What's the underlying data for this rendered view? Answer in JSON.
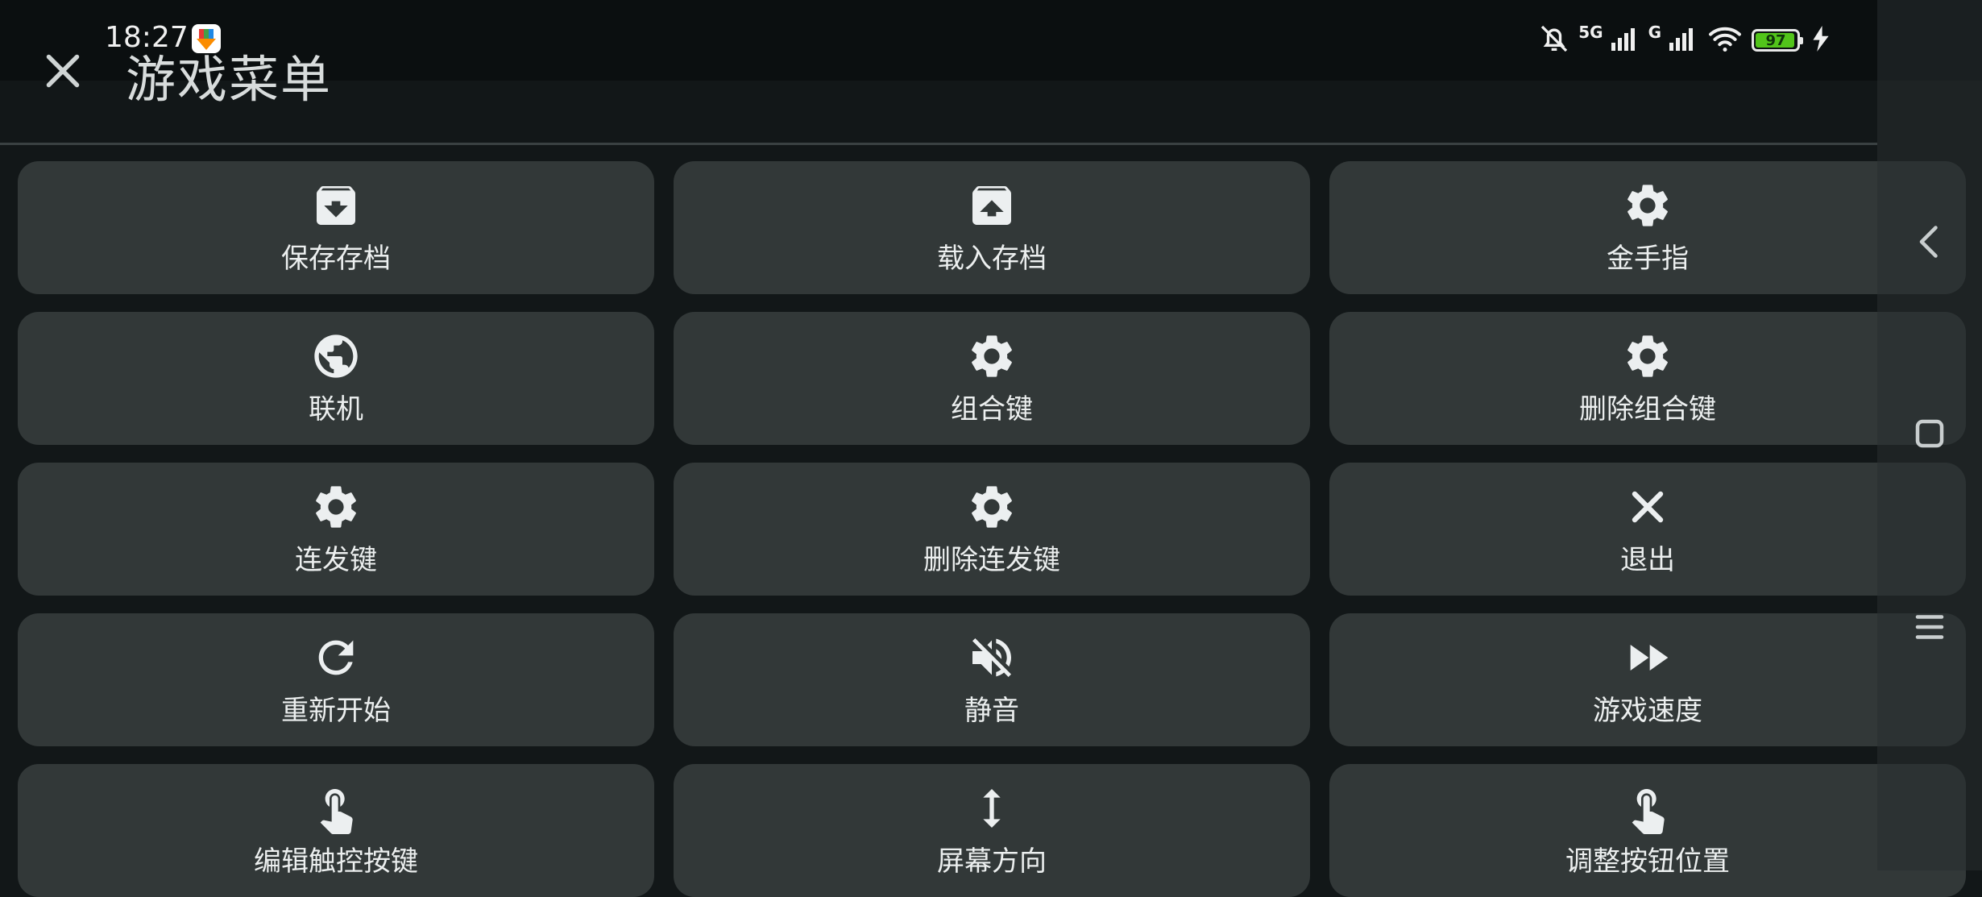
{
  "status_bar": {
    "time": "18:27",
    "network_1": "5G",
    "network_2": "G",
    "battery_percent": 97,
    "battery_text": "97",
    "icons": [
      "app-notification-icon",
      "mute-bell-icon",
      "signal-icon",
      "wifi-icon",
      "battery-icon",
      "charging-icon"
    ]
  },
  "header": {
    "title": "游戏菜单",
    "close_icon": "close-icon"
  },
  "menu": {
    "items": [
      {
        "label": "保存存档",
        "icon": "archive-save-icon"
      },
      {
        "label": "载入存档",
        "icon": "archive-load-icon"
      },
      {
        "label": "金手指",
        "icon": "gear-icon"
      },
      {
        "label": "联机",
        "icon": "globe-icon"
      },
      {
        "label": "组合键",
        "icon": "gear-icon"
      },
      {
        "label": "删除组合键",
        "icon": "gear-icon"
      },
      {
        "label": "连发键",
        "icon": "gear-icon"
      },
      {
        "label": "删除连发键",
        "icon": "gear-icon"
      },
      {
        "label": "退出",
        "icon": "close-icon"
      },
      {
        "label": "重新开始",
        "icon": "refresh-icon"
      },
      {
        "label": "静音",
        "icon": "volume-off-icon"
      },
      {
        "label": "游戏速度",
        "icon": "fast-forward-icon"
      },
      {
        "label": "编辑触控按键",
        "icon": "touch-icon"
      },
      {
        "label": "屏幕方向",
        "icon": "vertical-arrows-icon"
      },
      {
        "label": "调整按钮位置",
        "icon": "touch-icon"
      }
    ]
  },
  "nav_bar": {
    "icons": [
      "back-icon",
      "home-icon",
      "menu-icon"
    ]
  },
  "colors": {
    "background": "#121718",
    "card": "#323838",
    "text": "#ecefef",
    "battery": "#52c41a"
  }
}
